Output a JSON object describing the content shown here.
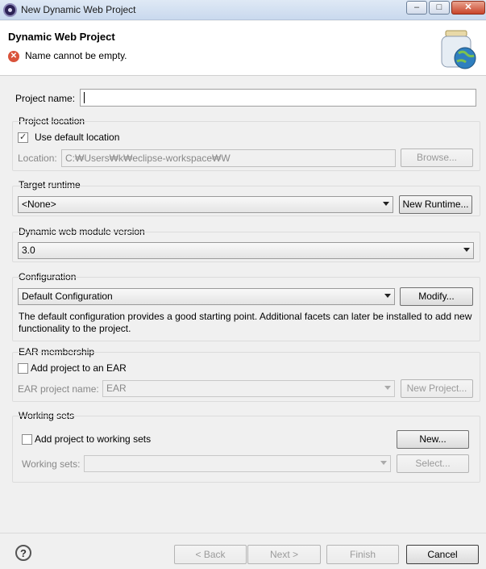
{
  "window": {
    "title": "New Dynamic Web Project",
    "min": "–",
    "max": "□",
    "close": "✕"
  },
  "header": {
    "title": "Dynamic Web Project",
    "error": "Name cannot be empty."
  },
  "project_name": {
    "label": "Project name:",
    "value": ""
  },
  "project_location": {
    "group_label": "Project location",
    "use_default_label": "Use default location",
    "use_default_checked": true,
    "location_label": "Location:",
    "location_value": "C:₩Users₩k₩eclipse-workspace₩W",
    "browse_label": "Browse..."
  },
  "target_runtime": {
    "group_label": "Target runtime",
    "selected": "<None>",
    "new_runtime_label": "New Runtime..."
  },
  "module_version": {
    "group_label": "Dynamic web module version",
    "selected": "3.0"
  },
  "configuration": {
    "group_label": "Configuration",
    "selected": "Default Configuration",
    "modify_label": "Modify...",
    "description": "The default configuration provides a good starting point. Additional facets can later be installed to add new functionality to the project."
  },
  "ear": {
    "group_label": "EAR membership",
    "add_label": "Add project to an EAR",
    "add_checked": false,
    "name_label": "EAR project name:",
    "name_value": "EAR",
    "new_project_label": "New Project..."
  },
  "working_sets": {
    "group_label": "Working sets",
    "add_label": "Add project to working sets",
    "add_checked": false,
    "new_label": "New...",
    "sets_label": "Working sets:",
    "sets_value": "",
    "select_label": "Select..."
  },
  "footer": {
    "help": "?",
    "back": "< Back",
    "next": "Next >",
    "finish": "Finish",
    "cancel": "Cancel"
  }
}
